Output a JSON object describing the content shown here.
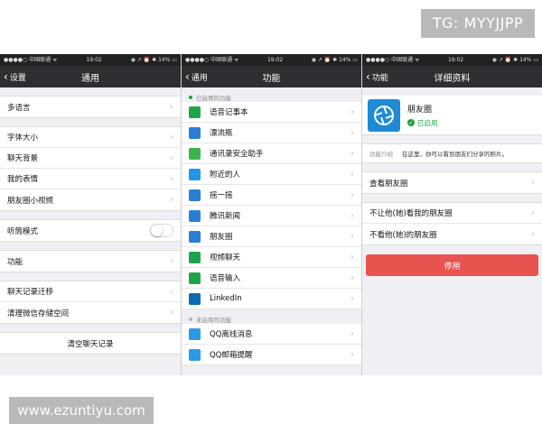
{
  "watermarks": {
    "top": "TG: MYYJJPP",
    "bottom": "www.ezuntiyu.com"
  },
  "status_bar": {
    "carrier": "●●●●○ 中国联通 ᯤ",
    "time": "19:02",
    "right": "◉ ↗ ⏰ ✱ 14% ▭"
  },
  "screen1": {
    "back_label": "设置",
    "title": "通用",
    "items": {
      "language": "多语言",
      "font_size": "字体大小",
      "chat_bg": "聊天背景",
      "my_stickers": "我的表情",
      "moments_video": "朋友圈小视频",
      "earpiece_mode": "听筒模式",
      "features": "功能",
      "chat_migrate": "聊天记录迁移",
      "clear_storage": "清理微信存储空间",
      "clear_chat": "清空聊天记录"
    },
    "earpiece_on": false
  },
  "screen2": {
    "back_label": "通用",
    "title": "功能",
    "enabled_label": "已启用的功能",
    "disabled_label": "未启用的功能",
    "enabled": [
      {
        "label": "语音记事本",
        "icon": "notebook-icon",
        "color": "#1fa34a"
      },
      {
        "label": "漂流瓶",
        "icon": "drift-bottle-icon",
        "color": "#2a7fd4"
      },
      {
        "label": "通讯录安全助手",
        "icon": "contacts-security-icon",
        "color": "#3db24a"
      },
      {
        "label": "附近的人",
        "icon": "people-nearby-icon",
        "color": "#2196e6"
      },
      {
        "label": "摇一摇",
        "icon": "shake-icon",
        "color": "#2a7fd4"
      },
      {
        "label": "腾讯新闻",
        "icon": "news-icon",
        "color": "#2a7fd4"
      },
      {
        "label": "朋友圈",
        "icon": "moments-icon",
        "color": "#2a7fd4"
      },
      {
        "label": "视频聊天",
        "icon": "video-chat-icon",
        "color": "#1fa34a"
      },
      {
        "label": "语音输入",
        "icon": "voice-input-icon",
        "color": "#1fa34a"
      },
      {
        "label": "LinkedIn",
        "icon": "linkedin-icon",
        "color": "#0b6bb0"
      }
    ],
    "disabled": [
      {
        "label": "QQ离线消息",
        "icon": "qq-icon",
        "color": "#2a9be6"
      },
      {
        "label": "QQ邮箱提醒",
        "icon": "qq-mail-icon",
        "color": "#2a9be6"
      }
    ]
  },
  "screen3": {
    "back_label": "功能",
    "title": "详细资料",
    "app_name": "朋友圈",
    "app_status": "已启用",
    "intro_key": "功能介绍",
    "intro_value": "在这里，你可以看到朋友们分享的照片。",
    "view_moments": "查看朋友圈",
    "hide_from": "不让他(她)看我的朋友圈",
    "dont_see": "不看他(她)的朋友圈",
    "disable_btn": "停用"
  },
  "colors": {
    "enabled_dot": "#1aa33c",
    "disabled_dot": "#b5b5b5",
    "danger": "#e85350",
    "nav_bg": "#2e2e32"
  }
}
